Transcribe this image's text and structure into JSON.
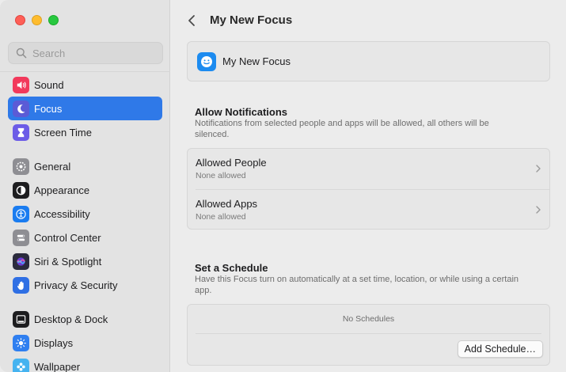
{
  "window": {
    "traffic_lights": {
      "close": "#fe5f57",
      "minimize": "#febc2e",
      "maximize": "#28c840"
    }
  },
  "sidebar": {
    "search": {
      "placeholder": "Search"
    },
    "groups": [
      [
        {
          "label": "Sound",
          "icon": "speaker-icon",
          "color": "#f2395b",
          "selected": false
        },
        {
          "label": "Focus",
          "icon": "moon-icon",
          "color": "#5b5bd6",
          "selected": true
        },
        {
          "label": "Screen Time",
          "icon": "hourglass-icon",
          "color": "#6c5ce7",
          "selected": false
        }
      ],
      [
        {
          "label": "General",
          "icon": "gear-icon",
          "color": "#8e8e93",
          "selected": false
        },
        {
          "label": "Appearance",
          "icon": "appearance-icon",
          "color": "#1d1d1f",
          "selected": false
        },
        {
          "label": "Accessibility",
          "icon": "accessibility-icon",
          "color": "#1a7cf0",
          "selected": false
        },
        {
          "label": "Control Center",
          "icon": "control-center-icon",
          "color": "#8e8e93",
          "selected": false
        },
        {
          "label": "Siri & Spotlight",
          "icon": "siri-icon",
          "color": "#2b2b3d",
          "selected": false
        },
        {
          "label": "Privacy & Security",
          "icon": "hand-icon",
          "color": "#2f6fe4",
          "selected": false
        }
      ],
      [
        {
          "label": "Desktop & Dock",
          "icon": "dock-icon",
          "color": "#1d1d1f",
          "selected": false
        },
        {
          "label": "Displays",
          "icon": "sun-icon",
          "color": "#2f7ff0",
          "selected": false
        },
        {
          "label": "Wallpaper",
          "icon": "wallpaper-icon",
          "color": "#45b3f0",
          "selected": false
        }
      ]
    ]
  },
  "main": {
    "title": "My New Focus",
    "focus_card": {
      "name": "My New Focus",
      "icon": "smiley-icon",
      "color": "#1c8bf0"
    },
    "allow": {
      "title": "Allow Notifications",
      "description": "Notifications from selected people and apps will be allowed, all others will be silenced.",
      "rows": [
        {
          "title": "Allowed People",
          "subtitle": "None allowed"
        },
        {
          "title": "Allowed Apps",
          "subtitle": "None allowed"
        }
      ]
    },
    "schedule": {
      "title": "Set a Schedule",
      "description": "Have this Focus turn on automatically at a set time, location, or while using a certain app.",
      "empty_text": "No Schedules",
      "add_button": "Add Schedule…"
    }
  }
}
